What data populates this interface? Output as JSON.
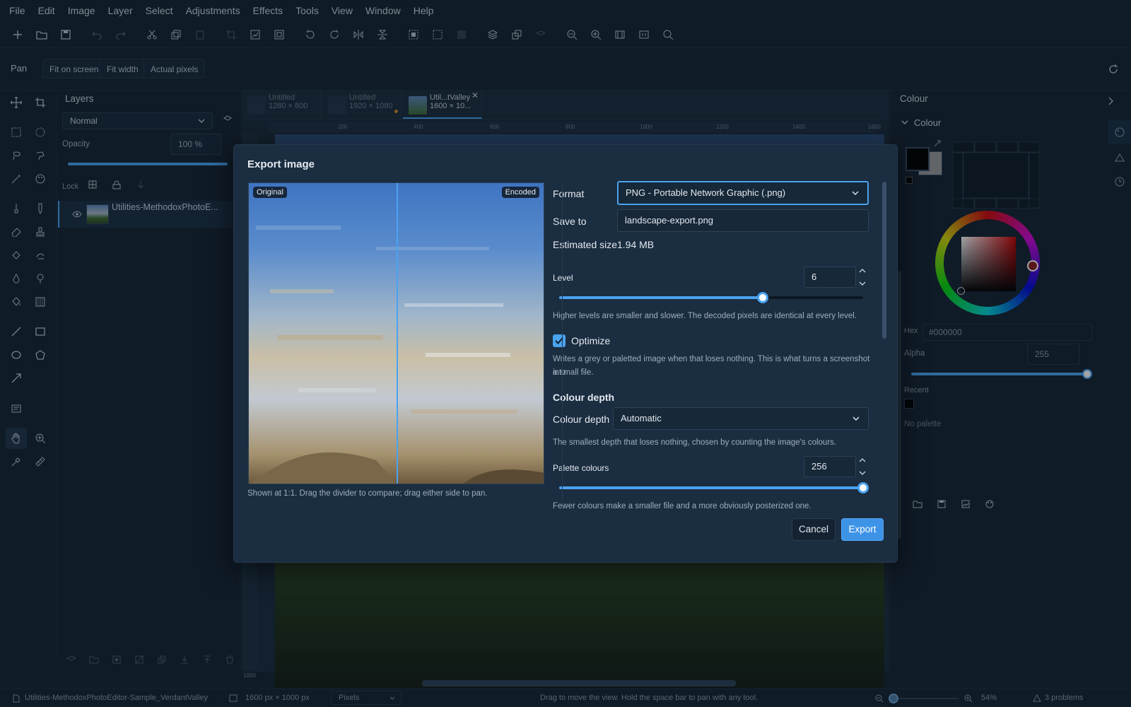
{
  "menu": [
    "File",
    "Edit",
    "Image",
    "Layer",
    "Select",
    "Adjustments",
    "Effects",
    "Tools",
    "View",
    "Window",
    "Help"
  ],
  "options": {
    "tool_name": "Pan",
    "fit_screen": "Fit on screen",
    "fit_width": "Fit width",
    "actual_pixels": "Actual pixels"
  },
  "layers": {
    "title": "Layers",
    "blend_mode": "Normal",
    "opacity_label": "Opacity",
    "opacity_value": "100 %",
    "lock_label": "Lock",
    "items": [
      {
        "name": "Utilities-MethodoxPhotoE..."
      }
    ]
  },
  "documents": [
    {
      "name": "Untitled",
      "size": "1280 × 800"
    },
    {
      "name": "Untitled",
      "size": "1920 × 1080"
    },
    {
      "name": "Util...tValley",
      "size": "1600 × 10..."
    }
  ],
  "ruler": {
    "ticks": [
      "200",
      "400",
      "600",
      "800",
      "1000",
      "1200",
      "1400",
      "1600"
    ],
    "side": "1000"
  },
  "colour_panel": {
    "header": "Colour",
    "section": "Colour",
    "hex_label": "Hex",
    "hex_value": "#000000",
    "alpha_label": "Alpha",
    "alpha_value": "255",
    "recent_label": "Recent",
    "palette_label": "No palette",
    "primary": "#000000",
    "secondary": "#9a9a9a"
  },
  "dialog": {
    "title": "Export image",
    "preview": {
      "original_label": "Original",
      "encoded_label": "Encoded",
      "divider": 0.5,
      "caption": "Shown at 1:1. Drag the divider to compare; drag either side to pan."
    },
    "format_label": "Format",
    "format_value": "PNG - Portable Network Graphic  (.png)",
    "save_to_label": "Save to",
    "save_to_value": "landscape-export.png",
    "estimated_size_label": "Estimated size",
    "estimated_size_value": "1.94 MB",
    "level_label": "Level",
    "level_value": "6",
    "level_fraction": 0.67,
    "level_help": "Higher levels are smaller and slower. The decoded pixels are identical at every level.",
    "optimize_label": "Optimize",
    "optimize_checked": true,
    "optimize_help_1": "Writes a grey or paletted image when that loses nothing. This is what turns a screenshot into",
    "optimize_help_2": "a small file.",
    "colour_depth_heading": "Colour depth",
    "colour_depth_label": "Colour depth",
    "colour_depth_value": "Automatic",
    "colour_depth_help": "The smallest depth that loses nothing, chosen by counting the image's colours.",
    "palette_label": "Palette colours",
    "palette_value": "256",
    "palette_fraction": 1.0,
    "palette_help": "Fewer colours make a smaller file and a more obviously posterized one.",
    "cancel": "Cancel",
    "export": "Export"
  },
  "status": {
    "filename": "Utilities-MethodoxPhotoEditor-Sample_VerdantValley",
    "dimensions": "1600 px × 1000 px",
    "units": "Pixels",
    "hint": "Drag to move the view. Hold the space bar to pan with any tool.",
    "zoom": "54%",
    "problems": "3 problems"
  },
  "colors": {
    "accent": "#4aa3f0",
    "bg": "#142231",
    "dialog": "#1b2d40"
  }
}
